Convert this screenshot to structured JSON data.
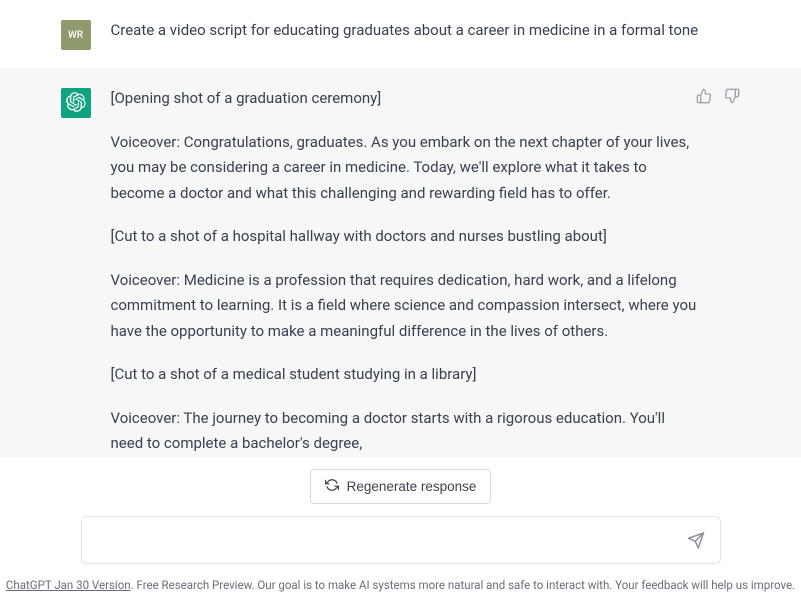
{
  "user": {
    "initials": "WR",
    "prompt": "Create a video script for educating graduates about a career in medicine in a formal tone"
  },
  "assistant": {
    "paragraphs": [
      "[Opening shot of a graduation ceremony]",
      "Voiceover: Congratulations, graduates. As you embark on the next chapter of your lives, you may be considering a career in medicine. Today, we'll explore what it takes to become a doctor and what this challenging and rewarding field has to offer.",
      "[Cut to a shot of a hospital hallway with doctors and nurses bustling about]",
      "Voiceover: Medicine is a profession that requires dedication, hard work, and a lifelong commitment to learning. It is a field where science and compassion intersect, where you have the opportunity to make a meaningful difference in the lives of others.",
      "[Cut to a shot of a medical student studying in a library]",
      "Voiceover: The journey to becoming a doctor starts with a rigorous education. You'll need to complete a bachelor's degree,"
    ]
  },
  "controls": {
    "regenerate_label": "Regenerate response",
    "input_placeholder": ""
  },
  "footer": {
    "version": "ChatGPT Jan 30 Version",
    "disclaimer": ". Free Research Preview. Our goal is to make AI systems more natural and safe to interact with. Your feedback will help us improve."
  }
}
